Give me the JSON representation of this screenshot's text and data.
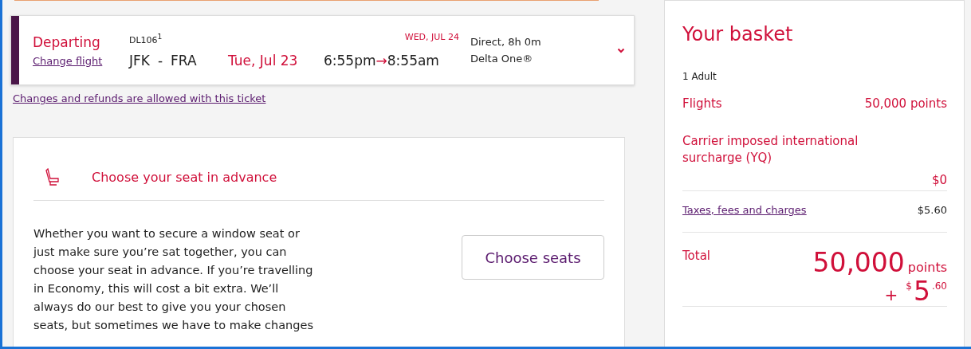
{
  "flight": {
    "direction": "Departing",
    "change_link": "Change flight",
    "flight_number": "DL106$^{1}$",
    "route_from": "JFK",
    "route_sep": "-",
    "route_to": "FRA",
    "depart_date": "Tue, Jul 23",
    "arrive_date": "WED, JUL 24",
    "depart_time": "6:55pm",
    "arrow": "→",
    "arrive_time": "8:55am",
    "duration": "Direct, 8h 0m",
    "cabin": "Delta One®",
    "expanded": false
  },
  "refund_link": "Changes and refunds are allowed with this ticket",
  "seat_section": {
    "title": "Choose your seat in advance",
    "body": "Whether you want to secure a window seat or just make sure you’re sat together, you can choose your seat in advance. If you’re travelling in Economy, this will cost a bit extra. We’ll always do our best to give you your chosen seats, but sometimes we have to make changes",
    "button": "Choose seats"
  },
  "basket": {
    "title": "Your basket",
    "passengers": "1 Adult",
    "lines": [
      {
        "kind": "plain",
        "label": "Flights",
        "value": "50,000 points"
      },
      {
        "kind": "stacked",
        "label": "Carrier imposed international surcharge (YQ)",
        "value": "$0"
      },
      {
        "kind": "link",
        "label": "Taxes, fees and charges",
        "value": "$5.60"
      }
    ],
    "total": {
      "label": "Total",
      "points_amount": "50,000",
      "points_unit": "points",
      "plus": "+",
      "currency": "$",
      "cash_whole": "5",
      "cash_cents": ".60"
    }
  }
}
